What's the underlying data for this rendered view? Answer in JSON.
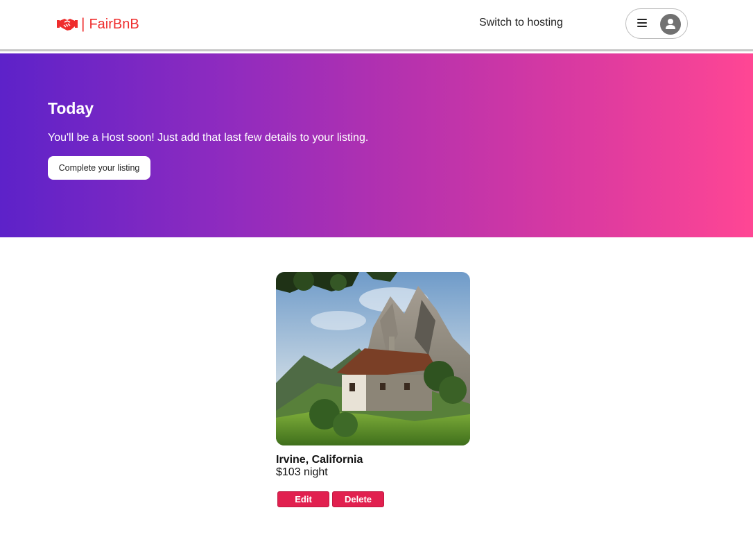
{
  "header": {
    "brand": "FairBnB",
    "brand_separator": "|",
    "logo_icon": "handshake-icon",
    "switch_label": "Switch to hosting",
    "menu_icon": "hamburger-menu-icon",
    "avatar_icon": "user-avatar-icon"
  },
  "hero": {
    "title": "Today",
    "subtitle": "You'll be a Host soon! Just add that last few details to your listing.",
    "button_label": "Complete your listing"
  },
  "listing": {
    "location": "Irvine, California",
    "price": "$103 night",
    "edit_label": "Edit",
    "delete_label": "Delete"
  },
  "colors": {
    "brand": "#ef2d2d",
    "hero_gradient_start": "#5d22c9",
    "hero_gradient_end": "#ff4694",
    "action_button": "#e1204f"
  }
}
